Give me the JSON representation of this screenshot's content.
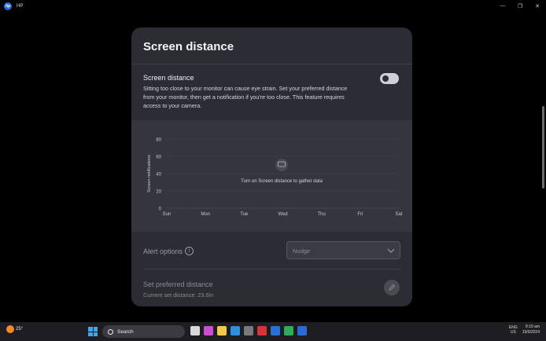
{
  "window": {
    "title": "HP",
    "minimize": "—",
    "restore": "❐",
    "close": "✕"
  },
  "card": {
    "title": "Screen distance",
    "setting_label": "Screen distance",
    "setting_desc": "Sitting too close to your monitor can cause eye strain. Set your preferred distance from your monitor, then get a notification if you're too close. This feature requires access to your camera.",
    "toggle_on": false
  },
  "chart_data": {
    "type": "line",
    "categories": [
      "Sun",
      "Mon",
      "Tue",
      "Wed",
      "Thu",
      "Fri",
      "Sat"
    ],
    "series": [],
    "ylabel": "Screen notifications",
    "xlabel": "",
    "ylim": [
      0,
      80
    ],
    "yticks": [
      0,
      20,
      40,
      60,
      80
    ],
    "grid": true,
    "empty_message": "Turn on Screen distance to gather data"
  },
  "alert": {
    "label": "Alert options",
    "info": "i",
    "selected": "Nudge"
  },
  "preferred": {
    "label": "Set preferred distance",
    "current": "Current set distance: 23.6in"
  },
  "taskbar": {
    "temp": "25°",
    "search": "Search",
    "lang": "ENG",
    "region": "US",
    "time": "9:10 am",
    "date": "19/5/2024"
  },
  "colors": {
    "card_bg": "#2b2c34",
    "chart_bg": "#34353d",
    "page_bg": "#000000"
  }
}
